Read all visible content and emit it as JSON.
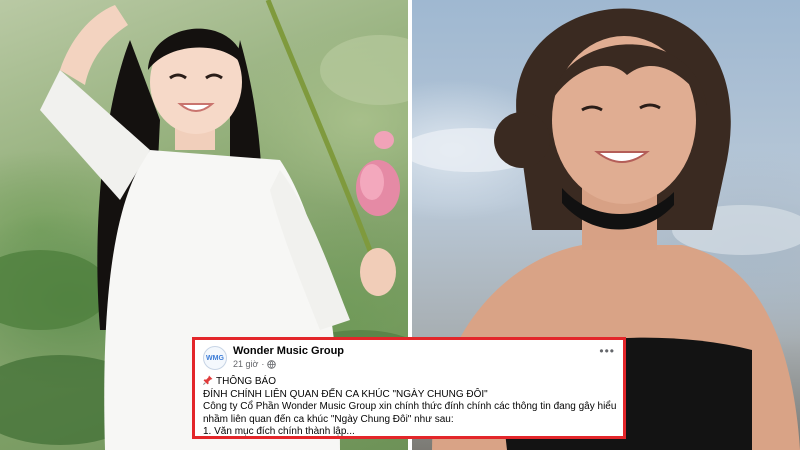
{
  "post": {
    "page_name": "Wonder Music Group",
    "avatar_text": "WMG",
    "time": "21 giờ",
    "separator": "·",
    "audience_icon": "globe-icon",
    "more_icon": "more-icon",
    "lines": [
      "THÔNG BÁO",
      "ĐÍNH CHÍNH LIÊN QUAN ĐẾN CA KHÚC \"NGÀY CHUNG ĐÔI\"",
      "Công ty Cổ Phần Wonder Music Group xin chính thức đính chính các thông tin đang gây hiểu",
      "nhầm liên quan đến ca khúc \"Ngày Chung Đôi\" như sau:",
      "1. Văn mục đích chính thành lập..."
    ]
  },
  "colors": {
    "highlight_border": "#e3262a",
    "link_blue": "#3b7bd6"
  }
}
